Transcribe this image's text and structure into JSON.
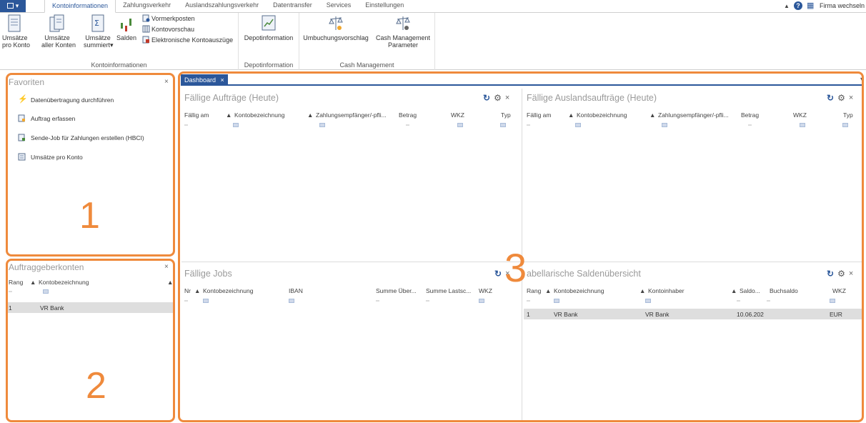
{
  "ribbon_tabs": [
    "Kontoinformationen",
    "Zahlungsverkehr",
    "Auslandszahlungsverkehr",
    "Datentransfer",
    "Services",
    "Einstellungen"
  ],
  "top_right": {
    "firm_label": "Firma wechseln"
  },
  "ribbon": {
    "group1": {
      "label": "Kontoinformationen",
      "umsaetze_konto": "Umsätze\npro Konto",
      "umsaetze_alle": "Umsätze\naller Konten",
      "umsaetze_summiert": "Umsätze\nsummiert",
      "salden": "Salden",
      "vormerkposten": "Vormerkposten",
      "kontovorschau": "Kontovorschau",
      "auszuege": "Elektronische Kontoauszüge"
    },
    "group2": {
      "label": "Depotinformation",
      "depot": "Depotinformation"
    },
    "group3": {
      "label": "Cash Management",
      "umbuchung": "Umbuchungsvorschlag",
      "cash_param": "Cash Management\nParameter"
    }
  },
  "favoriten": {
    "title": "Favoriten",
    "items": [
      "Datenübertragung durchführen",
      "Auftrag erfassen",
      "Sende-Job für Zahlungen erstellen (HBCI)",
      "Umsätze pro Konto"
    ],
    "number": "1"
  },
  "auftraggeber": {
    "title": "Auftraggeberkonten",
    "columns": [
      "Rang",
      "Kontobezeichnung"
    ],
    "rows": [
      [
        "1",
        "VR Bank"
      ]
    ],
    "number": "2"
  },
  "dashboard": {
    "tab_label": "Dashboard",
    "number": "3",
    "faellige_auftraege": {
      "title": "Fällige Aufträge (Heute)",
      "columns": [
        "Fällig am",
        "Kontobezeichnung",
        "Zahlungsempfänger/-pfli...",
        "Betrag",
        "WKZ",
        "Typ"
      ]
    },
    "faellige_ausland": {
      "title": "Fällige Auslandsaufträge (Heute)",
      "columns": [
        "Fällig am",
        "Kontobezeichnung",
        "Zahlungsempfänger/-pfli...",
        "Betrag",
        "WKZ",
        "Typ"
      ]
    },
    "faellige_jobs": {
      "title": "Fällige Jobs",
      "columns": [
        "Nr",
        "Kontobezeichnung",
        "IBAN",
        "Summe Über...",
        "Summe Lastsc...",
        "WKZ"
      ]
    },
    "salden": {
      "title": "abellarische Saldenübersicht",
      "columns": [
        "Rang",
        "Kontobezeichnung",
        "Kontoinhaber",
        "Saldo...",
        "Buchsaldo",
        "WKZ"
      ],
      "rows": [
        [
          "1",
          "VR Bank",
          "VR Bank",
          "10.06.202",
          "",
          "EUR"
        ]
      ]
    }
  },
  "colors": {
    "accent": "#2b579a",
    "highlight": "#ef8a3c"
  }
}
